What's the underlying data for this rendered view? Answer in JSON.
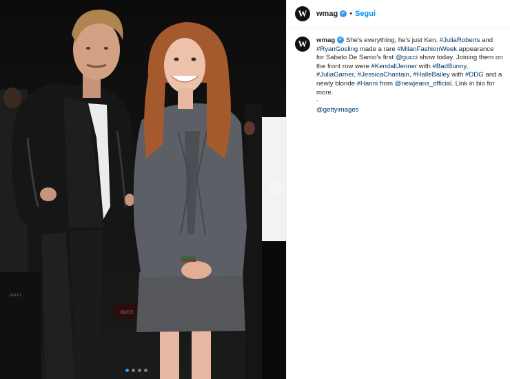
{
  "post": {
    "username": "wmag",
    "separator": "•",
    "follow_label": "Segui",
    "avatar_letter": "W",
    "caption": {
      "username": "wmag",
      "segments": [
        {
          "text": " She's everything, he's just Ken. ",
          "type": "text"
        },
        {
          "text": "#JuliaRoberts",
          "type": "tag"
        },
        {
          "text": " and ",
          "type": "text"
        },
        {
          "text": "#RyanGosling",
          "type": "tag"
        },
        {
          "text": " made a rare ",
          "type": "text"
        },
        {
          "text": "#MilanFashionWeek",
          "type": "tag"
        },
        {
          "text": " appearance for Sabato De Sarno's first ",
          "type": "text"
        },
        {
          "text": "@gucci",
          "type": "tag"
        },
        {
          "text": " show today. Joining them on the front row were ",
          "type": "text"
        },
        {
          "text": "#KendallJenner",
          "type": "tag"
        },
        {
          "text": " with ",
          "type": "text"
        },
        {
          "text": "#BadBunny",
          "type": "tag"
        },
        {
          "text": ", ",
          "type": "text"
        },
        {
          "text": "#JuliaGarner",
          "type": "tag"
        },
        {
          "text": ", ",
          "type": "text"
        },
        {
          "text": "#JessicaChastain",
          "type": "tag"
        },
        {
          "text": ", ",
          "type": "text"
        },
        {
          "text": "#HalleBailey",
          "type": "tag"
        },
        {
          "text": " with ",
          "type": "text"
        },
        {
          "text": "#DDG",
          "type": "tag"
        },
        {
          "text": " and a newly blonde ",
          "type": "text"
        },
        {
          "text": "#Hanni",
          "type": "tag"
        },
        {
          "text": " from ",
          "type": "text"
        },
        {
          "text": "@newjeans_official",
          "type": "tag"
        },
        {
          "text": ". Link in bio for more.",
          "type": "text"
        }
      ],
      "dash": "-",
      "credit": "@gettyimages"
    }
  },
  "carousel": {
    "next_icon": "chevron-right-icon",
    "next_glyph": "›",
    "dot_count": 4,
    "active_index": 0
  },
  "colors": {
    "link": "#00376b",
    "follow": "#0095f6",
    "verified": "#3897f0",
    "photo_bg": "#0c0c0c"
  }
}
